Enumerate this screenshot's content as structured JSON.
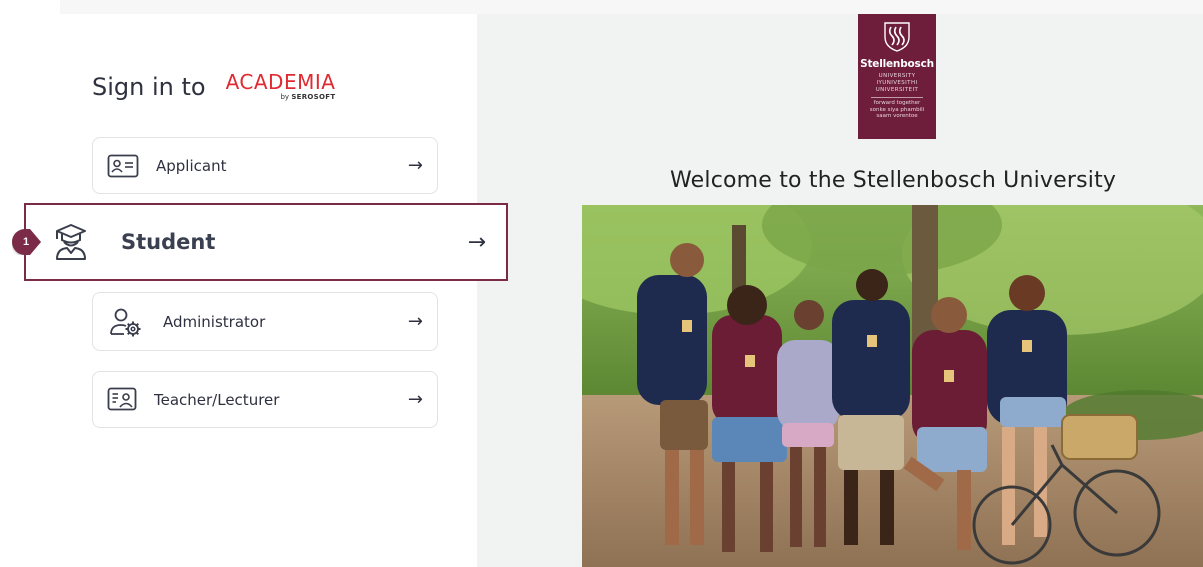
{
  "signin": {
    "prefix": "Sign in to",
    "brand_name": "ACADEMIA",
    "brand_by": "by",
    "brand_vendor": "SEROSOFT"
  },
  "roles": [
    {
      "label": "Applicant",
      "icon": "id-card-icon"
    },
    {
      "label": "Student",
      "icon": "graduate-icon"
    },
    {
      "label": "Administrator",
      "icon": "user-gear-icon"
    },
    {
      "label": "Teacher/Lecturer",
      "icon": "teacher-board-icon"
    }
  ],
  "arrow_glyph": "→",
  "step_badge": "1",
  "university": {
    "logo_name": "Stellenbosch",
    "logo_lines": [
      "UNIVERSITY",
      "IYUNIVESITHI",
      "UNIVERSITEIT"
    ],
    "tagline_lines": [
      "forward together",
      "sonke siya phambili",
      "saam vorentoe"
    ],
    "welcome": "Welcome to the Stellenbosch University",
    "brand_color": "#6e1d3a"
  },
  "colors": {
    "accent": "#7b2a48",
    "academia_red": "#e02a31",
    "right_bg": "#f1f2f2"
  }
}
